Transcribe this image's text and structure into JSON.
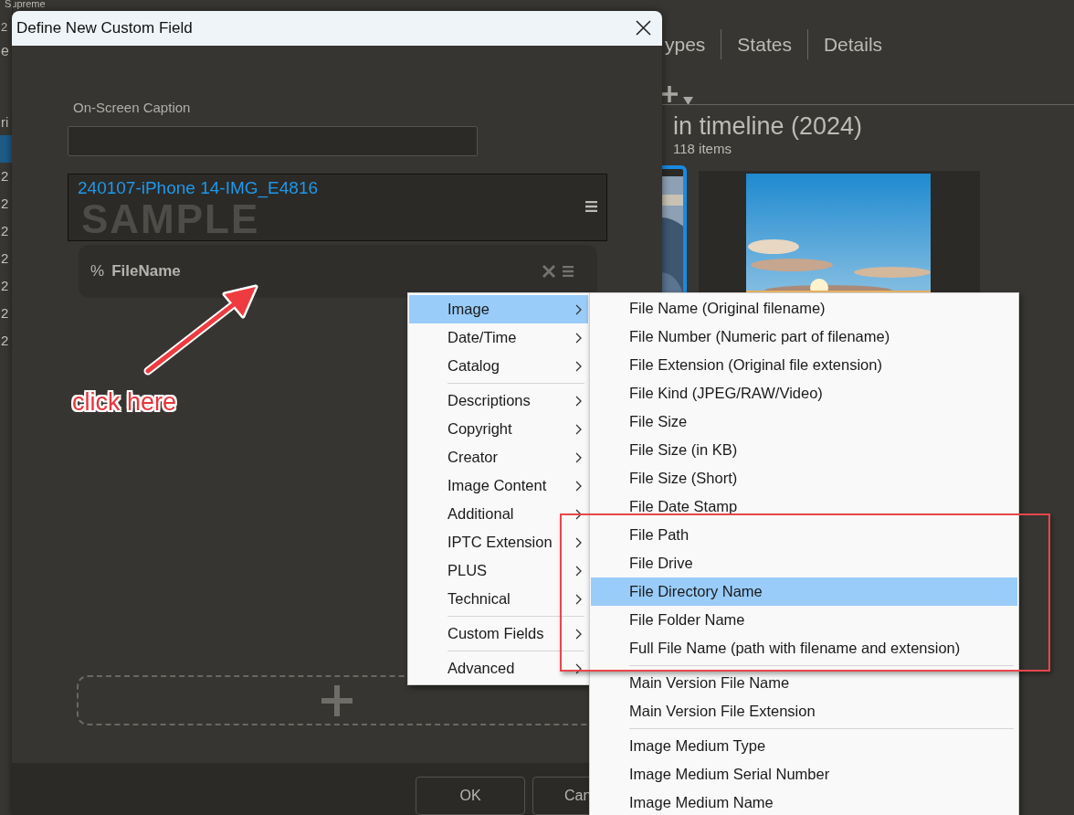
{
  "app": {
    "title": "Supreme",
    "subtitle": "2",
    "section_label": "e",
    "list_header": "ri",
    "list_items": [
      {
        "selected": true
      },
      {
        "label": "2",
        "selected": false
      },
      {
        "label": "2",
        "selected": false
      },
      {
        "label": "2",
        "selected": false
      },
      {
        "label": "2",
        "selected": false
      },
      {
        "label": "2",
        "selected": false
      },
      {
        "label": "2",
        "selected": false
      },
      {
        "label": "2",
        "selected": false
      }
    ],
    "tabs": [
      {
        "label": "ypes"
      },
      {
        "label": "States"
      },
      {
        "label": "Details"
      }
    ],
    "heading": "in timeline (2024)",
    "count": "118 items",
    "thumbnails": [
      {
        "kind": "picture",
        "selected": true
      },
      {
        "kind": "picture",
        "selected": false
      }
    ]
  },
  "dialog": {
    "title": "Define New Custom Field",
    "caption_label": "On-Screen Caption",
    "preview": {
      "text": "240107-iPhone 14-IMG_E4816",
      "background_text": "SAMPLE"
    },
    "token": {
      "prefix": "%",
      "label": "FileName"
    },
    "buttons": [
      "OK",
      "Can"
    ]
  },
  "menu": {
    "items": [
      {
        "kind": "item",
        "label": "Image",
        "selected": true
      },
      {
        "kind": "item",
        "label": "Date/Time",
        "selected": false
      },
      {
        "kind": "item",
        "label": "Catalog",
        "selected": false
      },
      {
        "kind": "separator"
      },
      {
        "kind": "item",
        "label": "Descriptions",
        "selected": false
      },
      {
        "kind": "item",
        "label": "Copyright",
        "selected": false
      },
      {
        "kind": "item",
        "label": "Creator",
        "selected": false
      },
      {
        "kind": "item",
        "label": "Image Content",
        "selected": false
      },
      {
        "kind": "item",
        "label": "Additional",
        "selected": false
      },
      {
        "kind": "item",
        "label": "IPTC Extension",
        "selected": false
      },
      {
        "kind": "item",
        "label": "PLUS",
        "selected": false
      },
      {
        "kind": "item",
        "label": "Technical",
        "selected": false
      },
      {
        "kind": "separator"
      },
      {
        "kind": "item",
        "label": "Custom Fields",
        "selected": false
      },
      {
        "kind": "separator"
      },
      {
        "kind": "item",
        "label": "Advanced",
        "selected": false
      }
    ]
  },
  "submenu": {
    "groups": [
      {
        "highlighted": false,
        "items": [
          {
            "label": "File Name (Original filename)",
            "selected": false
          },
          {
            "label": "File Number (Numeric part of filename)",
            "selected": false
          },
          {
            "label": "File Extension (Original file extension)",
            "selected": false
          },
          {
            "label": "File Kind (JPEG/RAW/Video)",
            "selected": false
          },
          {
            "label": "File Size",
            "selected": false
          },
          {
            "label": "File Size (in KB)",
            "selected": false
          },
          {
            "label": "File Size (Short)",
            "selected": false
          },
          {
            "label": "File Date Stamp",
            "selected": false
          }
        ]
      },
      {
        "highlighted": true,
        "items": [
          {
            "label": "File Path",
            "selected": false
          },
          {
            "label": "File Drive",
            "selected": false
          },
          {
            "label": "File Directory Name",
            "selected": true
          },
          {
            "label": "File Folder Name",
            "selected": false
          },
          {
            "label": "Full File Name (path with filename and extension)",
            "selected": false
          }
        ]
      },
      {
        "highlighted": false,
        "separator_before": true,
        "items": [
          {
            "label": "Main Version File Name",
            "selected": false
          },
          {
            "label": "Main Version File Extension",
            "selected": false
          }
        ]
      },
      {
        "highlighted": false,
        "separator_before": true,
        "items": [
          {
            "label": "Image Medium Type",
            "selected": false
          },
          {
            "label": "Image Medium Serial Number",
            "selected": false
          },
          {
            "label": "Image Medium Name",
            "selected": false
          }
        ]
      }
    ]
  },
  "annotation": {
    "callout": "click here"
  }
}
